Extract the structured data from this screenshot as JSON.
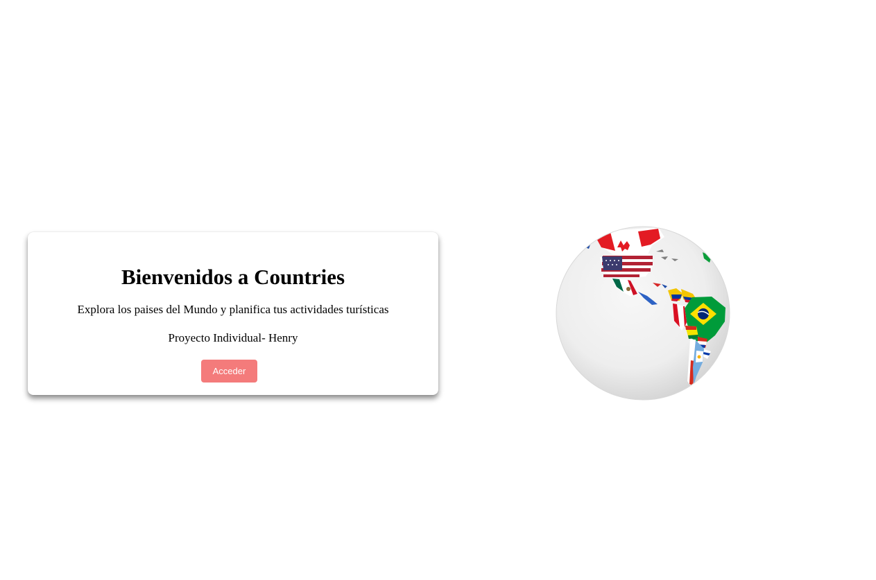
{
  "welcome": {
    "title": "Bienvenidos a Countries",
    "subtitle": "Explora los paises del Mundo y planifica tus actividades turísticas",
    "author": "Proyecto Individual- Henry",
    "button_label": "Acceder"
  },
  "colors": {
    "button": "#f47b7b",
    "button_text": "#ffffff",
    "globe_base": "#f1f1f1"
  },
  "globe": {
    "icon": "world-flags-globe-image",
    "flags_shown": [
      "Canada",
      "United States",
      "Mexico",
      "Colombia",
      "Venezuela",
      "Brazil",
      "Peru",
      "Bolivia",
      "Chile",
      "Argentina",
      "Paraguay",
      "Uruguay"
    ]
  }
}
